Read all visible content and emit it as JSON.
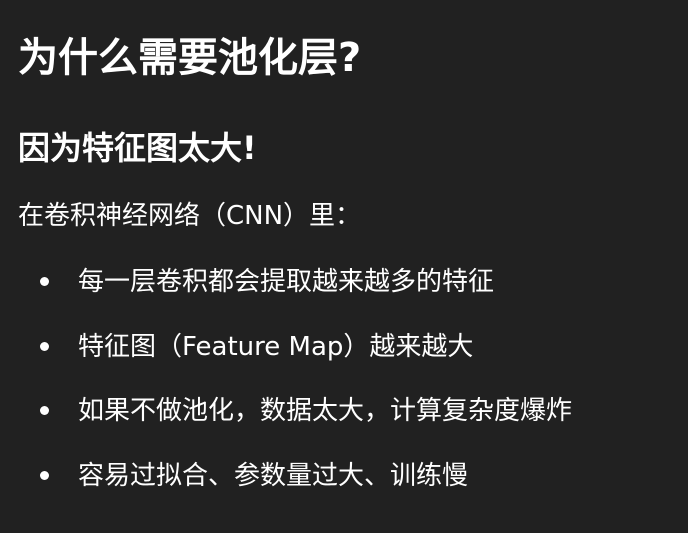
{
  "document": {
    "title": "为什么需要池化层?",
    "subtitle": "因为特征图太大!",
    "intro": "在卷积神经网络（CNN）里：",
    "bullets": [
      "每一层卷积都会提取越来越多的特征",
      "特征图（Feature Map）越来越大",
      "如果不做池化，数据太大，计算复杂度爆炸",
      "容易过拟合、参数量过大、训练慢"
    ]
  }
}
